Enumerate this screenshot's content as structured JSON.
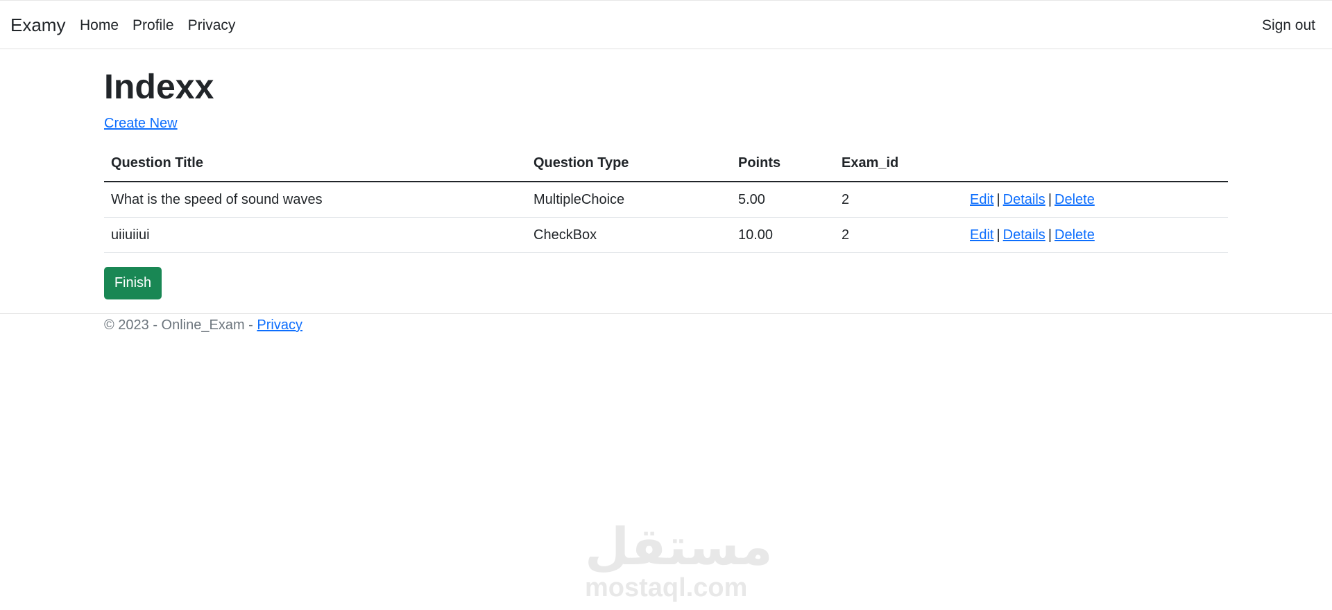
{
  "navbar": {
    "brand": "Examy",
    "links": [
      "Home",
      "Profile",
      "Privacy"
    ],
    "signout": "Sign out"
  },
  "page": {
    "title": "Indexx",
    "create_new": "Create New",
    "finish_label": "Finish"
  },
  "table": {
    "headers": [
      "Question Title",
      "Question Type",
      "Points",
      "Exam_id"
    ],
    "rows": [
      {
        "title": "What is the speed of sound waves",
        "type": "MultipleChoice",
        "points": "5.00",
        "exam_id": "2"
      },
      {
        "title": "uiiuiiui",
        "type": "CheckBox",
        "points": "10.00",
        "exam_id": "2"
      }
    ],
    "actions": {
      "edit": "Edit",
      "details": "Details",
      "delete": "Delete",
      "separator": "|"
    }
  },
  "footer": {
    "text": "© 2023 - Online_Exam - ",
    "privacy": "Privacy"
  },
  "watermark": {
    "arabic": "مستقل",
    "latin": "mostaql.com"
  },
  "colors": {
    "link": "#0d6efd",
    "finish_button": "#198754"
  }
}
